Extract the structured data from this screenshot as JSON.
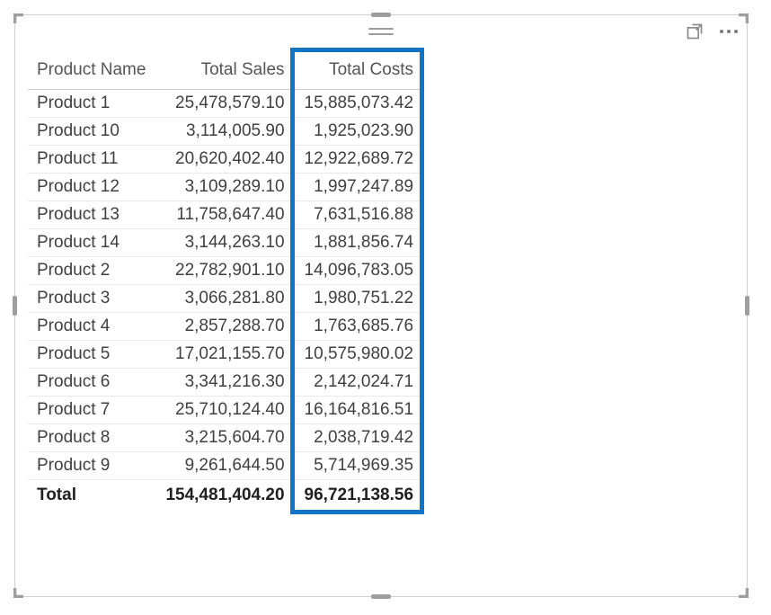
{
  "columns": {
    "product": "Product Name",
    "sales": "Total Sales",
    "costs": "Total Costs"
  },
  "rows": [
    {
      "product": "Product 1",
      "sales": "25,478,579.10",
      "costs": "15,885,073.42"
    },
    {
      "product": "Product 10",
      "sales": "3,114,005.90",
      "costs": "1,925,023.90"
    },
    {
      "product": "Product 11",
      "sales": "20,620,402.40",
      "costs": "12,922,689.72"
    },
    {
      "product": "Product 12",
      "sales": "3,109,289.10",
      "costs": "1,997,247.89"
    },
    {
      "product": "Product 13",
      "sales": "11,758,647.40",
      "costs": "7,631,516.88"
    },
    {
      "product": "Product 14",
      "sales": "3,144,263.10",
      "costs": "1,881,856.74"
    },
    {
      "product": "Product 2",
      "sales": "22,782,901.10",
      "costs": "14,096,783.05"
    },
    {
      "product": "Product 3",
      "sales": "3,066,281.80",
      "costs": "1,980,751.22"
    },
    {
      "product": "Product 4",
      "sales": "2,857,288.70",
      "costs": "1,763,685.76"
    },
    {
      "product": "Product 5",
      "sales": "17,021,155.70",
      "costs": "10,575,980.02"
    },
    {
      "product": "Product 6",
      "sales": "3,341,216.30",
      "costs": "2,142,024.71"
    },
    {
      "product": "Product 7",
      "sales": "25,710,124.40",
      "costs": "16,164,816.51"
    },
    {
      "product": "Product 8",
      "sales": "3,215,604.70",
      "costs": "2,038,719.42"
    },
    {
      "product": "Product 9",
      "sales": "9,261,644.50",
      "costs": "5,714,969.35"
    }
  ],
  "total": {
    "label": "Total",
    "sales": "154,481,404.20",
    "costs": "96,721,138.56"
  },
  "chart_data": {
    "type": "table",
    "title": "",
    "columns": [
      "Product Name",
      "Total Sales",
      "Total Costs"
    ],
    "rows": [
      [
        "Product 1",
        25478579.1,
        15885073.42
      ],
      [
        "Product 10",
        3114005.9,
        1925023.9
      ],
      [
        "Product 11",
        20620402.4,
        12922689.72
      ],
      [
        "Product 12",
        3109289.1,
        1997247.89
      ],
      [
        "Product 13",
        11758647.4,
        7631516.88
      ],
      [
        "Product 14",
        3144263.1,
        1881856.74
      ],
      [
        "Product 2",
        22782901.1,
        14096783.05
      ],
      [
        "Product 3",
        3066281.8,
        1980751.22
      ],
      [
        "Product 4",
        2857288.7,
        1763685.76
      ],
      [
        "Product 5",
        17021155.7,
        10575980.02
      ],
      [
        "Product 6",
        3341216.3,
        2142024.71
      ],
      [
        "Product 7",
        25710124.4,
        16164816.51
      ],
      [
        "Product 8",
        3215604.7,
        2038719.42
      ],
      [
        "Product 9",
        9261644.5,
        5714969.35
      ]
    ],
    "totals": {
      "Total Sales": 154481404.2,
      "Total Costs": 96721138.56
    },
    "highlighted_column": "Total Costs"
  }
}
